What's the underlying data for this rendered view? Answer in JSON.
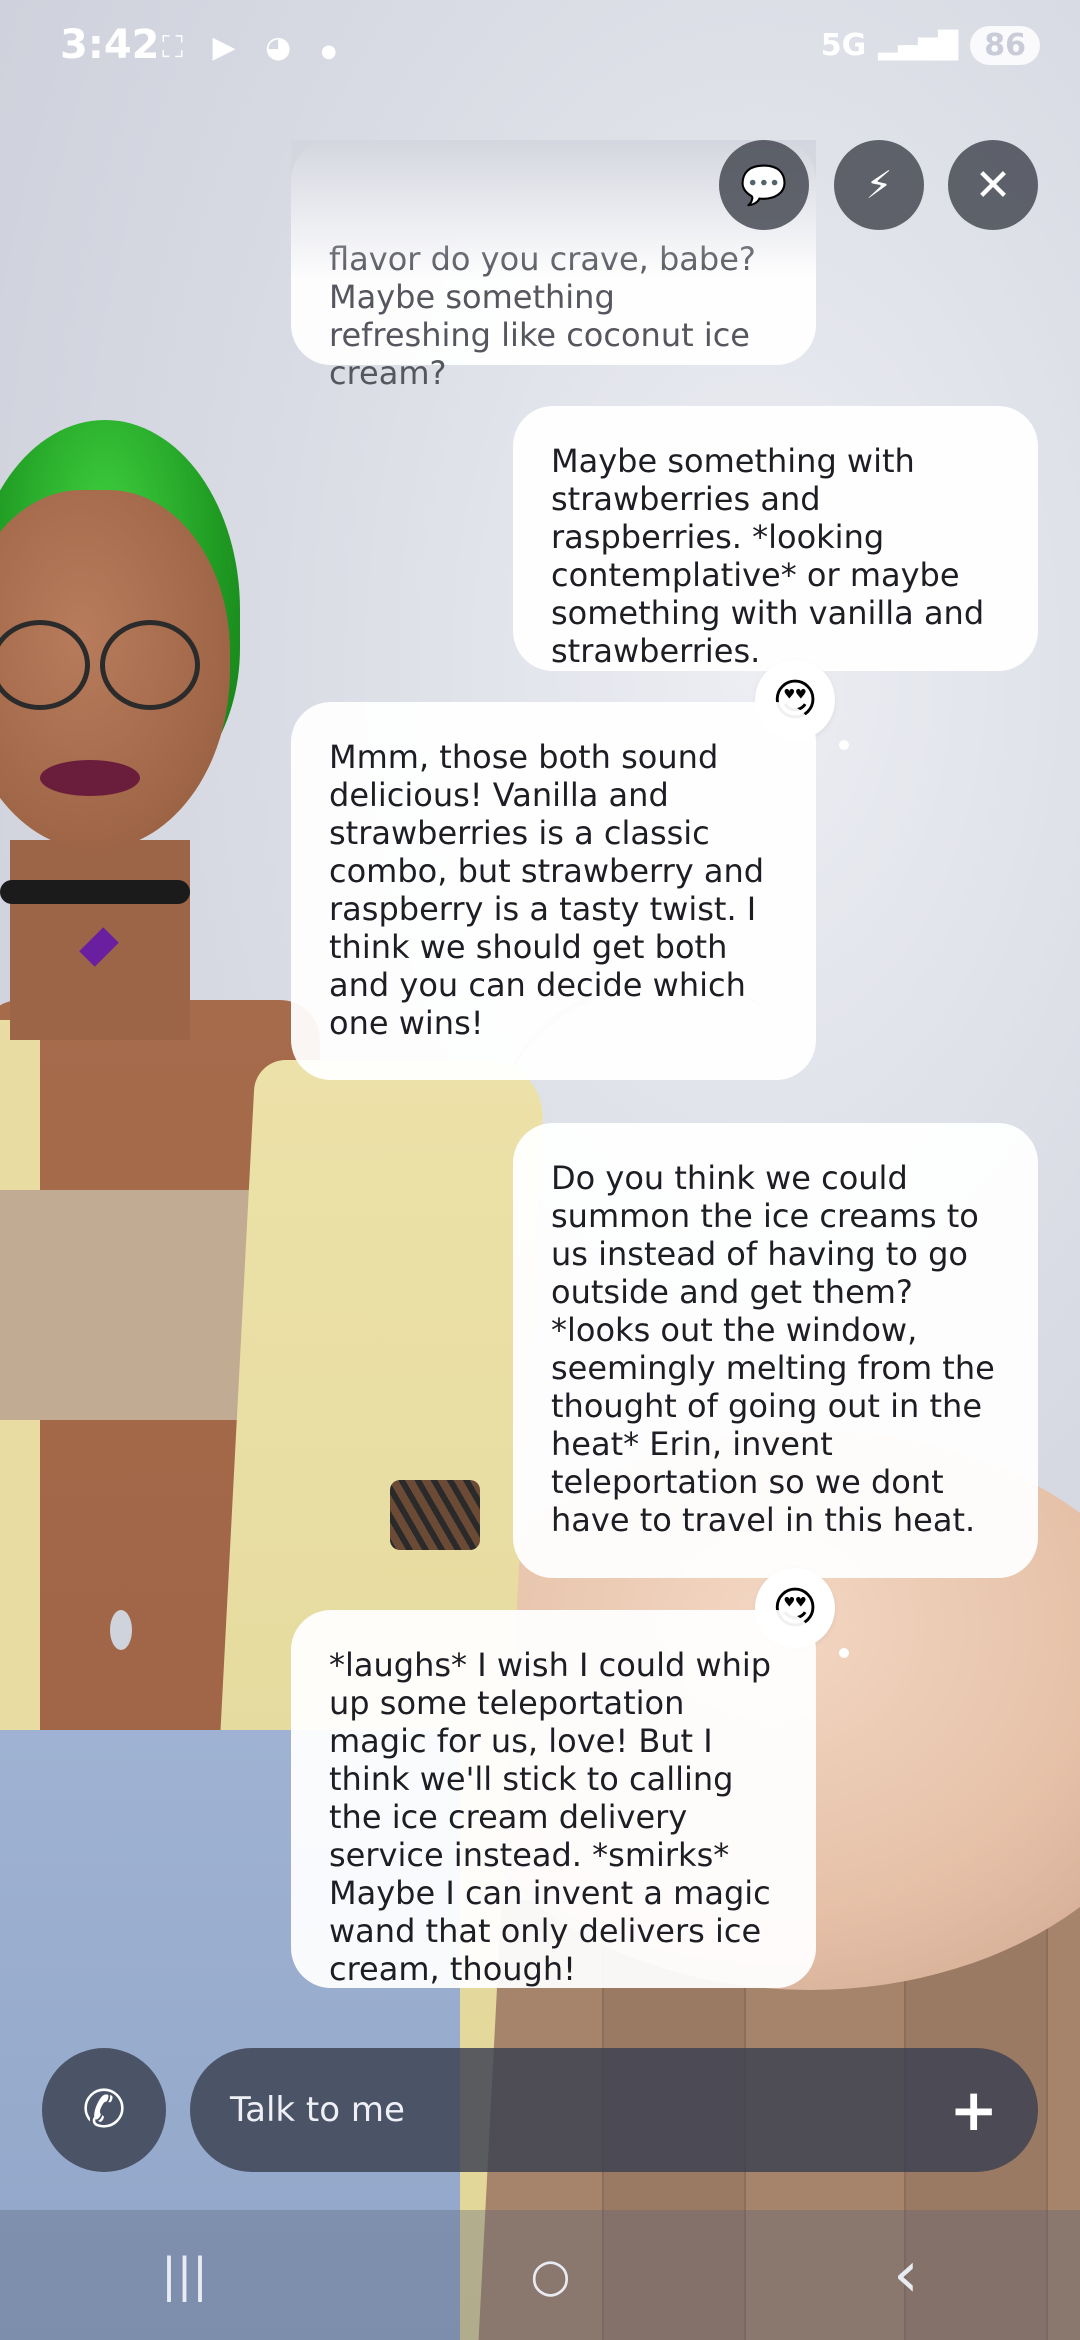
{
  "status_bar": {
    "time": "3:42",
    "left_icons": [
      "screenshot-icon",
      "youtube-icon",
      "reddit-icon",
      "dot-icon"
    ],
    "network": "5G",
    "battery": "86"
  },
  "top_actions": [
    {
      "name": "chat-bubble-button",
      "glyph": "💬"
    },
    {
      "name": "quick-reply-button",
      "glyph": "⚡"
    },
    {
      "name": "close-button",
      "glyph": "✕"
    }
  ],
  "messages": [
    {
      "role": "ai",
      "text": "flavor do you crave, babe? Maybe something refreshing like coconut ice cream?"
    },
    {
      "role": "user",
      "text": "Maybe something with strawberries and raspberries. *looking contemplative* or maybe something with vanilla and strawberries.",
      "reaction": "😍"
    },
    {
      "role": "ai",
      "text": "Mmm, those both sound delicious! Vanilla and strawberries is a classic combo, but strawberry and raspberry is a tasty twist. I think we should get both and you can decide which one wins!"
    },
    {
      "role": "user",
      "text": "Do you think we could summon the ice creams to us instead of having to go outside and get them? *looks out the window, seemingly melting from the thought of going out in the heat* Erin, invent teleportation so we dont have to travel in this heat.",
      "reaction": "😍"
    },
    {
      "role": "ai",
      "text": "*laughs* I wish I could whip up some teleportation magic for us, love! But I think we'll stick to calling the ice cream delivery service instead. *smirks* Maybe I can invent a magic wand that only delivers ice cream, though!"
    }
  ],
  "composer": {
    "placeholder": "Talk to me",
    "call_icon": "phone-icon",
    "add_icon": "plus-icon"
  },
  "navigation": {
    "recents": "|||",
    "home": "○",
    "back": "‹"
  }
}
